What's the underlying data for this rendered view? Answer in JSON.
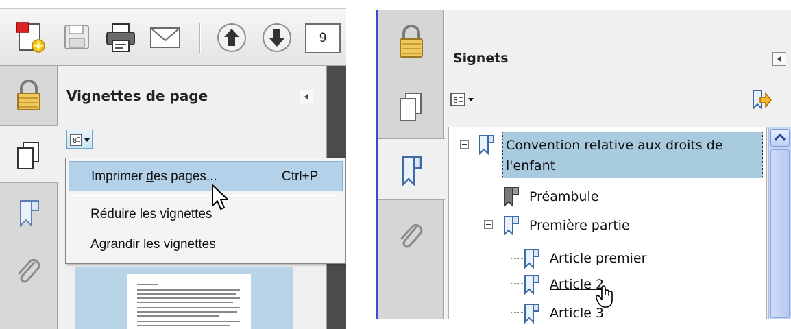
{
  "left": {
    "toolbar": {
      "page_number": "9",
      "icons": [
        "create-pdf-icon",
        "save-icon",
        "print-icon",
        "email-icon",
        "previous-page-icon",
        "next-page-icon"
      ]
    },
    "panel": {
      "title": "Vignettes de page"
    },
    "menu": {
      "items": [
        {
          "pre": "Imprimer ",
          "key": "d",
          "post": "es pages...",
          "shortcut": "Ctrl+P"
        },
        {
          "pre": "Réduire les ",
          "key": "v",
          "post": "ignettes",
          "shortcut": ""
        },
        {
          "pre": "A",
          "key": "g",
          "post": "randir les vignettes",
          "shortcut": ""
        }
      ]
    }
  },
  "right": {
    "panel": {
      "title": "Signets"
    },
    "bookmarks": {
      "root_line1": "Convention relative aux droits de",
      "root_line2": "l'enfant",
      "preambule": "Préambule",
      "part1": "Première partie",
      "article1": "Article premier",
      "article2": "Article 2",
      "article3": "Article 3"
    }
  },
  "colors": {
    "highlight": "#b3d1e8",
    "selected_bookmark": "#a9cbe0",
    "window_border": "#2d53c6"
  }
}
